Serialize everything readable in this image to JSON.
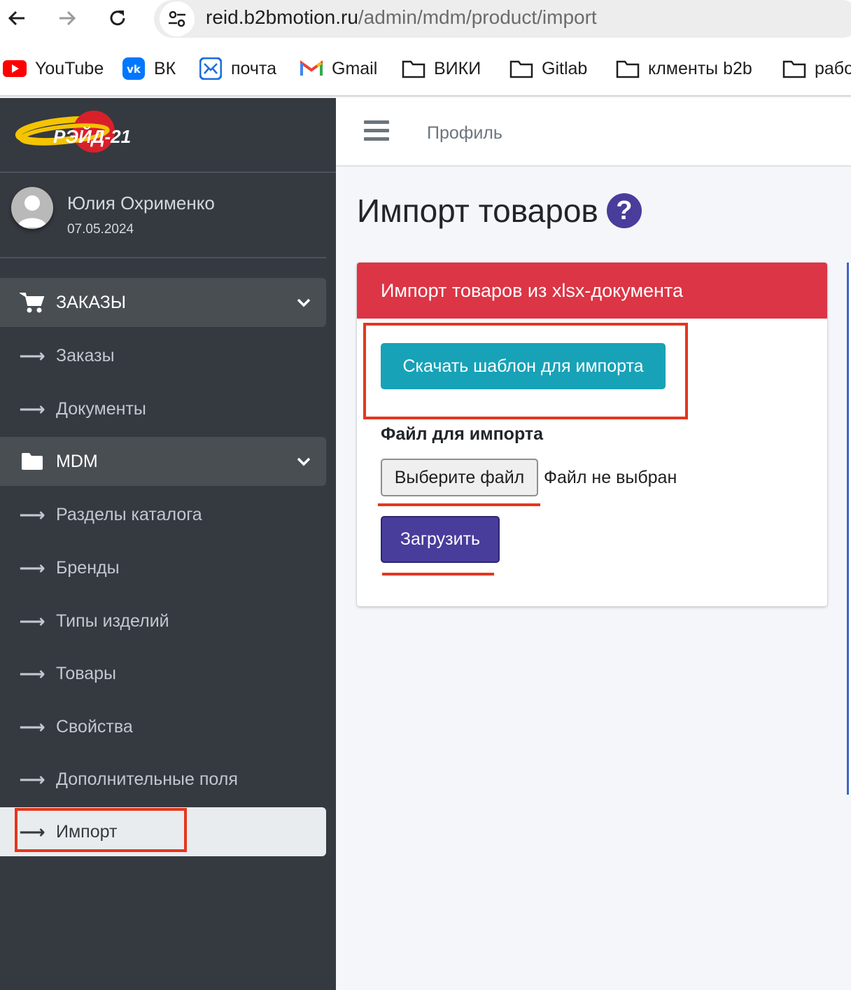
{
  "browser": {
    "url_host": "reid.b2bmotion.ru",
    "url_path": "/admin/mdm/product/import",
    "bookmarks": [
      {
        "label": "YouTube",
        "icon": "youtube-icon"
      },
      {
        "label": "ВК",
        "icon": "vk-icon"
      },
      {
        "label": "почта",
        "icon": "mail-icon"
      },
      {
        "label": "Gmail",
        "icon": "gmail-icon"
      },
      {
        "label": "ВИКИ",
        "icon": "folder-icon"
      },
      {
        "label": "Gitlab",
        "icon": "folder-icon"
      },
      {
        "label": "клменты b2b",
        "icon": "folder-icon"
      },
      {
        "label": "рабо",
        "icon": "folder-icon"
      }
    ]
  },
  "brand": {
    "logo_text": "РЭЙД-21"
  },
  "user": {
    "name": "Юлия Охрименко",
    "date": "07.05.2024"
  },
  "sidebar": {
    "items": [
      {
        "label": "ЗАКАЗЫ",
        "type": "header",
        "icon": "cart-icon"
      },
      {
        "label": "Заказы",
        "type": "link",
        "icon": "arrow-right-icon"
      },
      {
        "label": "Документы",
        "type": "link",
        "icon": "arrow-right-icon"
      },
      {
        "label": "MDM",
        "type": "header",
        "icon": "folder-icon"
      },
      {
        "label": "Разделы каталога",
        "type": "link",
        "icon": "arrow-right-icon"
      },
      {
        "label": "Бренды",
        "type": "link",
        "icon": "arrow-right-icon"
      },
      {
        "label": "Типы изделий",
        "type": "link",
        "icon": "arrow-right-icon"
      },
      {
        "label": "Товары",
        "type": "link",
        "icon": "arrow-right-icon"
      },
      {
        "label": "Свойства",
        "type": "link",
        "icon": "arrow-right-icon"
      },
      {
        "label": "Дополнительные поля",
        "type": "link",
        "icon": "arrow-right-icon"
      },
      {
        "label": "Импорт",
        "type": "active",
        "icon": "arrow-right-icon"
      }
    ]
  },
  "topnav": {
    "profile_label": "Профиль"
  },
  "page": {
    "title": "Импорт товаров",
    "help_glyph": "?"
  },
  "card": {
    "header": "Импорт товаров из xlsx-документа",
    "download_template_label": "Скачать шаблон для импорта",
    "file_label": "Файл для импорта",
    "choose_file_label": "Выберите файл",
    "file_status": "Файл не выбран",
    "upload_label": "Загрузить"
  },
  "colors": {
    "sidebar_bg": "#343a40",
    "card_header": "#dc3545",
    "template_button": "#17a2b8",
    "upload_button": "#483d9b",
    "annotation": "#e4361e"
  }
}
